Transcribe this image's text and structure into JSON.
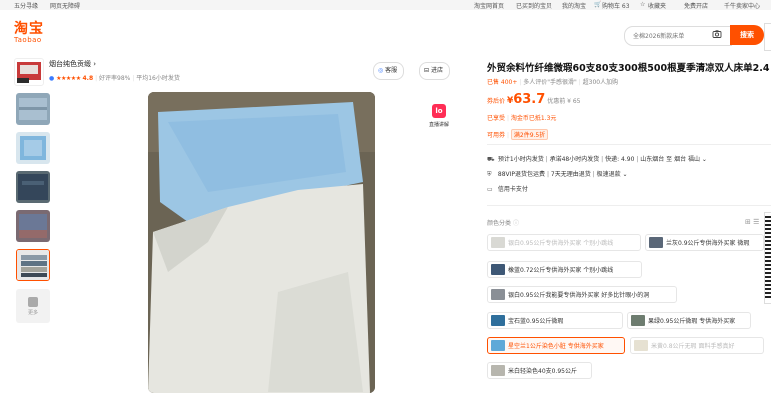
{
  "topbar": {
    "left": [
      "五分寻缘",
      "网页无障碍"
    ],
    "right": [
      "淘宝网首页",
      "已买到的宝贝",
      "我的淘宝",
      "购物车 63",
      "收藏夹",
      "免费开店",
      "千牛卖家中心"
    ]
  },
  "logo": {
    "cn": "淘宝",
    "en": "Taobao"
  },
  "search": {
    "placeholder": "全棉2026新款床单",
    "button": "搜索"
  },
  "shop": {
    "name": "烟台纯色贡缎",
    "stars": "★★★★★",
    "rating": "4.8",
    "positive": "好评率98%",
    "ship_time": "平均16小时发货",
    "service_btn": "客服",
    "enter_btn": "进店"
  },
  "live": {
    "label": "直播讲解",
    "icon_text": "lo"
  },
  "thumbs_more": "更多",
  "product": {
    "title": "外贸余料竹纤维微瑕60支80支300根500根夏季清凉双人床单2.4",
    "sold": "已售 400+",
    "reviews": "多人评价\"手感很滑\"",
    "carts": "超300人加购",
    "price_prefix": "券后价",
    "currency": "¥",
    "price": "63.7",
    "orig_label": "优惠前",
    "orig_price": "¥ 65",
    "promo1_label": "已享受",
    "promo1": "淘金币已抵1.3元",
    "promo2_label": "可用券",
    "promo2": "满2件9.5折"
  },
  "info": {
    "ship": "预计1小时内发货",
    "ship2": "承诺48小时内发货",
    "express": "快递: 4.90",
    "from": "山东烟台 至 烟台 福山",
    "vip": "88VIP退货包运费",
    "return": "7天无理由退货",
    "refund": "极速退款",
    "credit": "信用卡支付"
  },
  "options": {
    "label": "颜色分类",
    "items": [
      {
        "text": "银白0.95公斤专供海外买家 个别小跳线",
        "state": "dim",
        "swatch": "#d9d9d4"
      },
      {
        "text": "兰灰0.9公斤专供海外买家 微瑕",
        "state": "normal",
        "swatch": "#5a6778"
      },
      {
        "text": "橡蓝0.72公斤专供海外买家 个别小跳线",
        "state": "normal",
        "swatch": "#3e5876"
      },
      {
        "text": "银白0.95公斤我能要专供海外买家 好多比针眼小的洞",
        "state": "normal",
        "swatch": "#8a8f96"
      },
      {
        "text": "宝石蓝0.95公斤微瑕",
        "state": "normal",
        "swatch": "#2f6f9c"
      },
      {
        "text": "果绿0.95公斤微瑕 专供海外买家",
        "state": "normal",
        "swatch": "#6e7d70"
      },
      {
        "text": "星空兰1公斤染色小脏 专供海外买家",
        "state": "selected",
        "swatch": "#5fa9d8"
      },
      {
        "text": "米黄0.8公斤无瑕 面料手感真好",
        "state": "dim",
        "swatch": "#e6e1d2"
      },
      {
        "text": "米白轻染色40支0.95公斤",
        "state": "normal",
        "swatch": "#b7b6ae"
      }
    ]
  }
}
